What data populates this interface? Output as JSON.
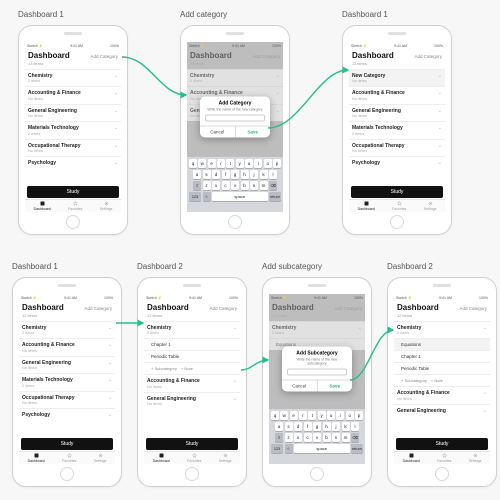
{
  "labels": {
    "row1": [
      "Dashboard 1",
      "Add category",
      "Dashboard 1"
    ],
    "row2": [
      "Dashboard 1",
      "Dashboard 2",
      "Add subcategory",
      "Dashboard 2"
    ]
  },
  "status": {
    "carrier": "Sketch ⚡",
    "time": "9:41 AM",
    "battery": "100%"
  },
  "header": {
    "title": "Dashboard",
    "addCategory": "Add Category",
    "count_13": "13 items",
    "count_12": "12 items"
  },
  "categories_base": [
    {
      "name": "Chemistry",
      "sub": "2 items"
    },
    {
      "name": "Accounting & Finance",
      "sub": "No items"
    },
    {
      "name": "General Engineering",
      "sub": "No items"
    },
    {
      "name": "Materials Technology",
      "sub": "2 items"
    },
    {
      "name": "Occupational Therapy",
      "sub": "No items"
    },
    {
      "name": "Psychology",
      "sub": ""
    }
  ],
  "categories_with_new": [
    {
      "name": "New Category",
      "sub": "No items",
      "hl": true
    },
    {
      "name": "Accounting & Finance",
      "sub": "No items"
    },
    {
      "name": "General Engineering",
      "sub": "No items"
    },
    {
      "name": "Materials Technology",
      "sub": "2 items"
    },
    {
      "name": "Occupational Therapy",
      "sub": "No items"
    },
    {
      "name": "Psychology",
      "sub": ""
    }
  ],
  "categories_expanded": [
    {
      "name": "Chemistry",
      "sub": "2 items"
    }
  ],
  "chem_children": {
    "chapter1": "Chapter 1",
    "periodic": "Periodic Table",
    "addSubcat": "+  Subcategory",
    "addNote": "+  Note"
  },
  "categories_after_chem": [
    {
      "name": "Accounting & Finance",
      "sub": "No items"
    },
    {
      "name": "General Engineering",
      "sub": "No items"
    }
  ],
  "categories_d2_final": [
    {
      "name": "Chemistry",
      "sub": "2 items"
    }
  ],
  "d2_final_children": {
    "equations": "Equations",
    "chapter1": "Chapter 1",
    "periodic": "Periodic Table",
    "addSubcat": "+  Subcategory",
    "addNote": "+  Note"
  },
  "categories_d2_final_after": [
    {
      "name": "Accounting & Finance",
      "sub": "No items"
    },
    {
      "name": "General Engineering",
      "sub": ""
    }
  ],
  "addsub_screen": {
    "chemistry": "Chemistry",
    "chemistry_sub": "2 items",
    "equations": "Equations"
  },
  "modal_cat": {
    "title": "Add Category",
    "subtitle": "Write the name of the new category",
    "cancel": "Cancel",
    "save": "Save"
  },
  "modal_subcat": {
    "title": "Add Subcategory",
    "subtitle": "Write the name of the new subcategory",
    "cancel": "Cancel",
    "save": "Save"
  },
  "study": "Study",
  "tabs": {
    "dashboard": "Dashboard",
    "favorites": "Favorites",
    "settings": "Settings"
  },
  "keyboard": {
    "r1": [
      "q",
      "w",
      "e",
      "r",
      "t",
      "y",
      "u",
      "i",
      "o",
      "p"
    ],
    "r2": [
      "a",
      "s",
      "d",
      "f",
      "g",
      "h",
      "j",
      "k",
      "l"
    ],
    "r3": [
      "⇧",
      "z",
      "x",
      "c",
      "v",
      "b",
      "n",
      "m",
      "⌫"
    ],
    "r4": [
      "123",
      "☺",
      "space",
      "return"
    ]
  },
  "arrow_color": "#23c08e"
}
